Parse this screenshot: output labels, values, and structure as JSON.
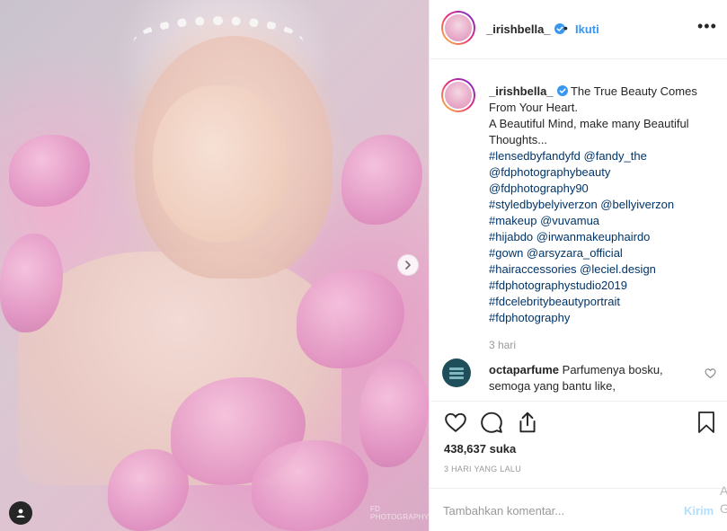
{
  "post": {
    "username": "_irishbella_",
    "follow_label": "Ikuti",
    "dot": "•",
    "more": "•••",
    "photo_watermark": "FD PHOTOGRAPHY",
    "caption": {
      "lines": [
        "The True Beauty Comes",
        "From Your Heart.",
        "A Beautiful Mind, make many Beautiful",
        "Thoughts..."
      ],
      "tags": [
        "#lensedbyfandyfd @fandy_the",
        "@fdphotographybeauty",
        "@fdphotography90",
        "#styledbybelyiverzon @bellyiverzon",
        "#makeup @vuvamua",
        "#hijabdo @irwanmakeuphairdo",
        "#gown @arsyzara_official",
        "#hairaccessories @leciel.design",
        "#fdphotographystudio2019",
        "#fdcelebritybeautyportrait",
        "#fdphotography"
      ],
      "time_ago": "3 hari"
    },
    "comment": {
      "username": "octaparfume",
      "text_line1": "Parfumenya bosku,",
      "text_line2": "semoga yang bantu like,"
    },
    "likes": "438,637 suka",
    "date": "3 HARI YANG LALU",
    "comment_input": {
      "placeholder": "Tambahkan komentar...",
      "value": ""
    },
    "post_label": "Kirim",
    "edge_text": "A\nG"
  },
  "colors": {
    "link": "#3897f0",
    "hashtag": "#003569",
    "post_disabled": "#b2dffc",
    "muted": "#999999"
  },
  "icons": [
    "verified-badge-icon",
    "more-options-icon",
    "heart-icon",
    "comment-icon",
    "share-icon",
    "bookmark-icon",
    "carousel-next-icon",
    "user-tag-icon"
  ]
}
